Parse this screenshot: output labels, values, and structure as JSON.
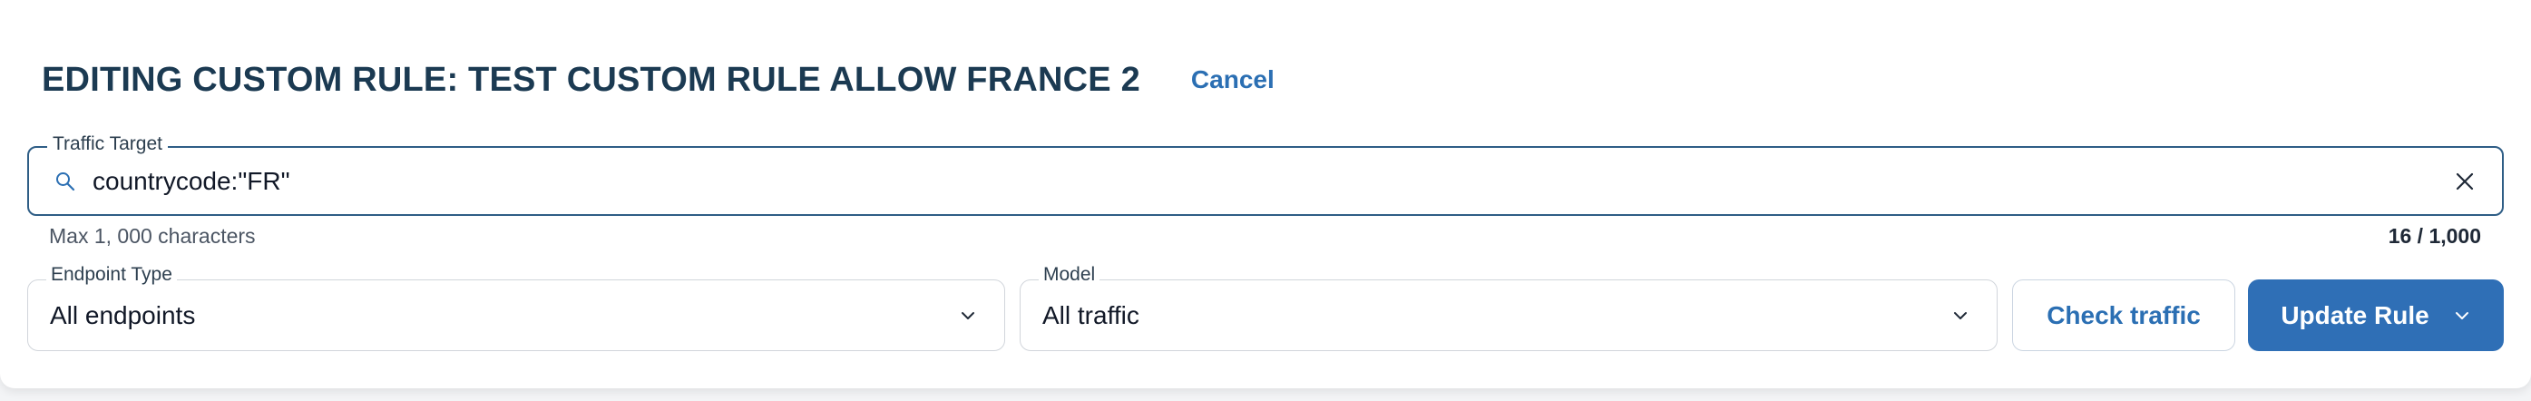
{
  "header": {
    "title": "EDITING CUSTOM RULE: TEST CUSTOM RULE ALLOW FRANCE 2",
    "cancel_label": "Cancel"
  },
  "traffic_target": {
    "label": "Traffic Target",
    "value": "countrycode:\"FR\"",
    "helper": "Max 1, 000 characters",
    "counter": "16 / 1,000",
    "icon": "search-icon",
    "clear_icon": "close-icon"
  },
  "endpoint_type": {
    "label": "Endpoint Type",
    "value": "All endpoints"
  },
  "model": {
    "label": "Model",
    "value": "All traffic"
  },
  "actions": {
    "check_traffic_label": "Check traffic",
    "update_rule_label": "Update Rule"
  },
  "colors": {
    "title": "#1b3a52",
    "accent": "#2b6fb3",
    "primary_button": "#2f6fb6",
    "focused_border": "#2f5e86"
  }
}
